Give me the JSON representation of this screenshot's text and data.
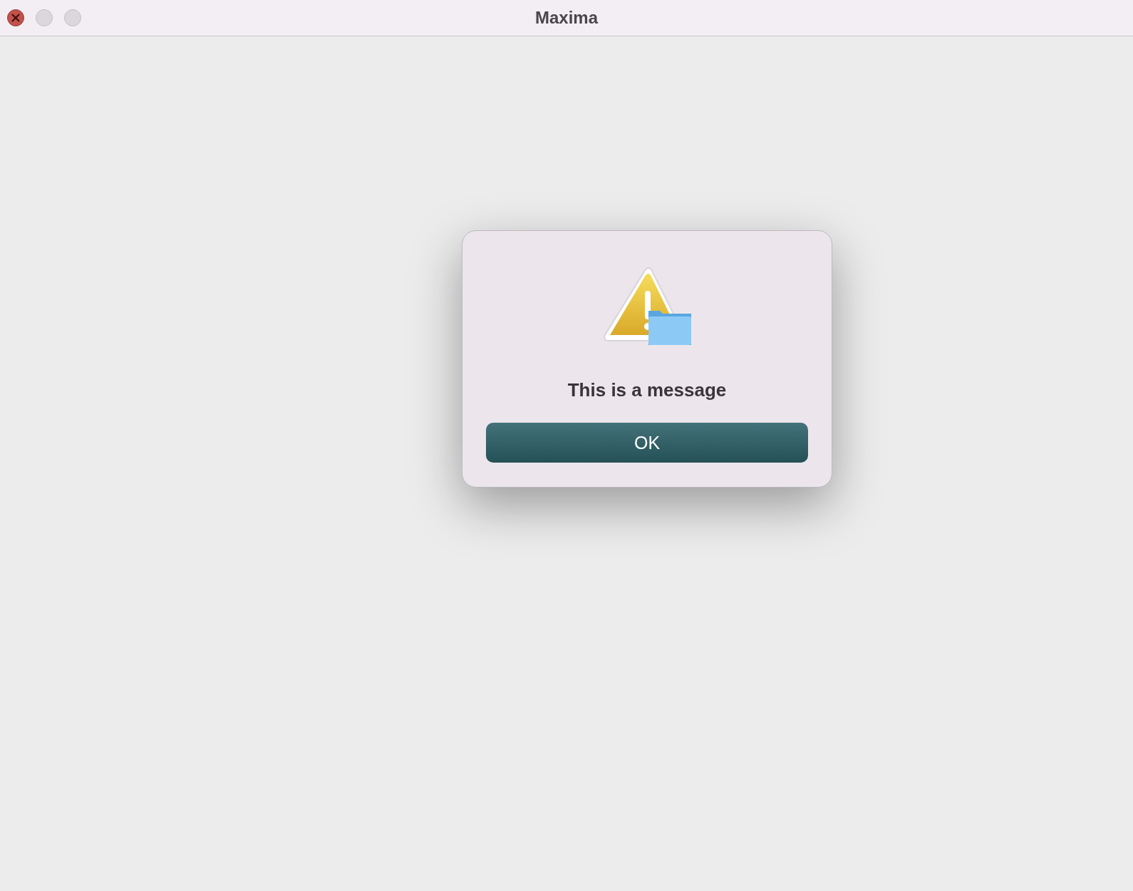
{
  "window": {
    "title": "Maxima"
  },
  "dialog": {
    "message": "This is a message",
    "buttons": [
      "OK"
    ]
  }
}
